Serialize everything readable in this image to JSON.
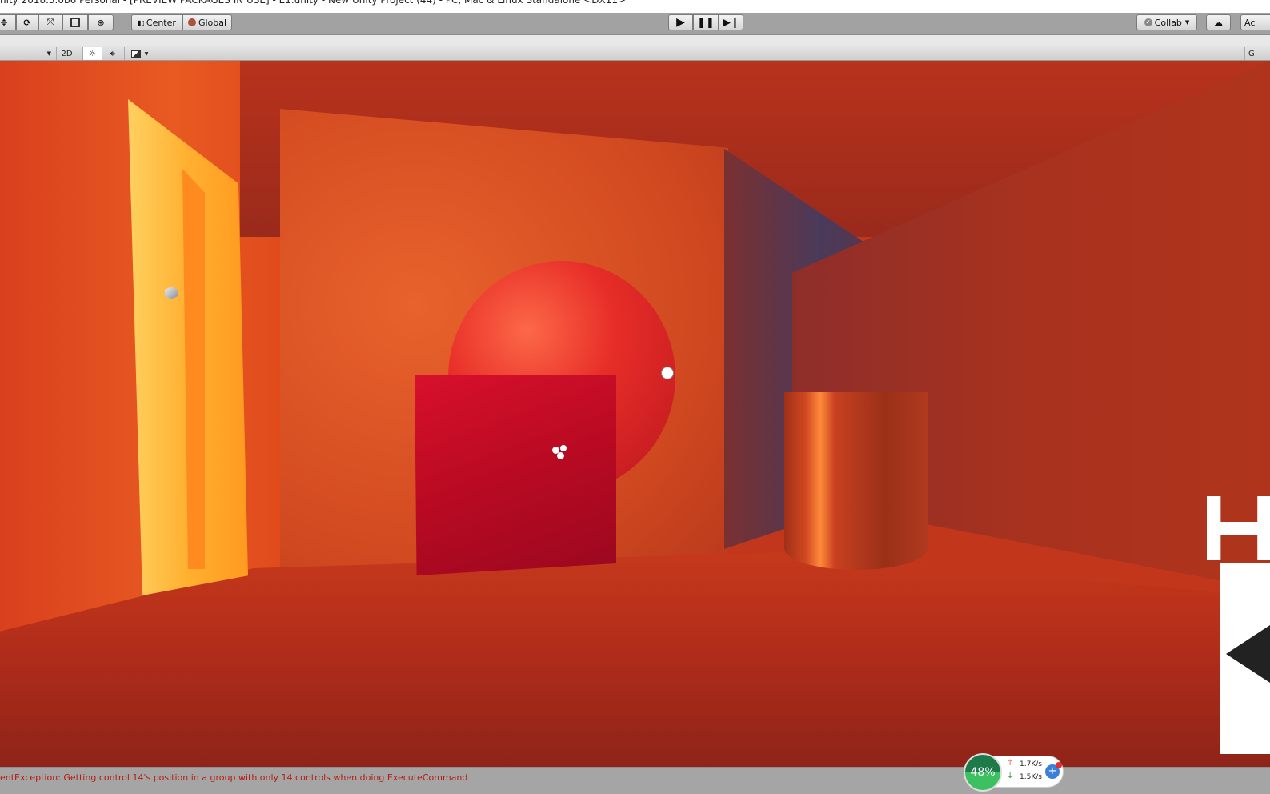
{
  "window": {
    "title": "nity 2018.3.0b6 Personal - [PREVIEW PACKAGES IN USE] - E1.unity - New Unity Project (44) - PC, Mac & Linux Standalone <DX11>"
  },
  "toolbar": {
    "pivot_label": "Center",
    "space_label": "Global",
    "collab_label": "Collab",
    "account_label": "Ac"
  },
  "scene_toolbar": {
    "mode_2d": "2D",
    "right_cut": "G"
  },
  "status": {
    "message": "entException: Getting control 14's position in a group with only 14 controls when doing ExecuteCommand"
  },
  "net_widget": {
    "percent": "48%",
    "upload": "1.7K/s",
    "download": "1.5K/s",
    "colors": {
      "ring": "#2a9a55",
      "up": "#e0564a",
      "down": "#3a9a4a",
      "boost": "#3b7fd8"
    }
  }
}
